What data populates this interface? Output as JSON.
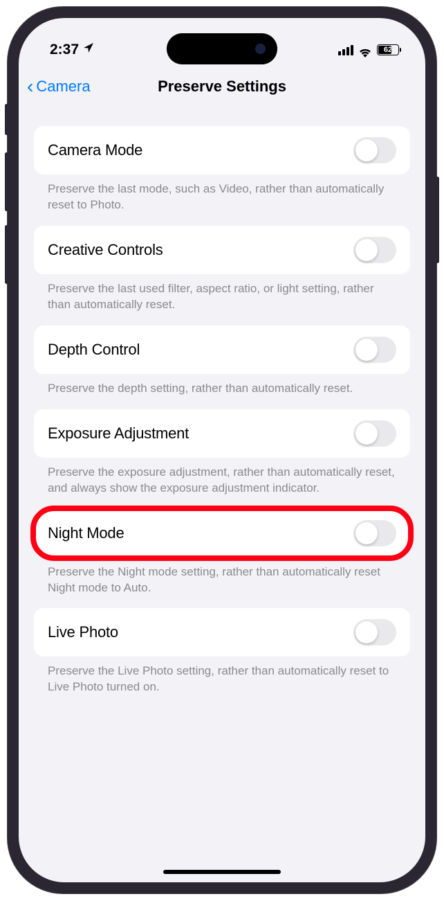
{
  "statusBar": {
    "time": "2:37",
    "battery": "62"
  },
  "nav": {
    "back": "Camera",
    "title": "Preserve Settings"
  },
  "settings": [
    {
      "label": "Camera Mode",
      "description": "Preserve the last mode, such as Video, rather than automatically reset to Photo.",
      "highlighted": false
    },
    {
      "label": "Creative Controls",
      "description": "Preserve the last used filter, aspect ratio, or light setting, rather than automatically reset.",
      "highlighted": false
    },
    {
      "label": "Depth Control",
      "description": "Preserve the depth setting, rather than automatically reset.",
      "highlighted": false
    },
    {
      "label": "Exposure Adjustment",
      "description": "Preserve the exposure adjustment, rather than automatically reset, and always show the exposure adjustment indicator.",
      "highlighted": false
    },
    {
      "label": "Night Mode",
      "description": "Preserve the Night mode setting, rather than automatically reset Night mode to Auto.",
      "highlighted": true
    },
    {
      "label": "Live Photo",
      "description": "Preserve the Live Photo setting, rather than automatically reset to Live Photo turned on.",
      "highlighted": false
    }
  ]
}
